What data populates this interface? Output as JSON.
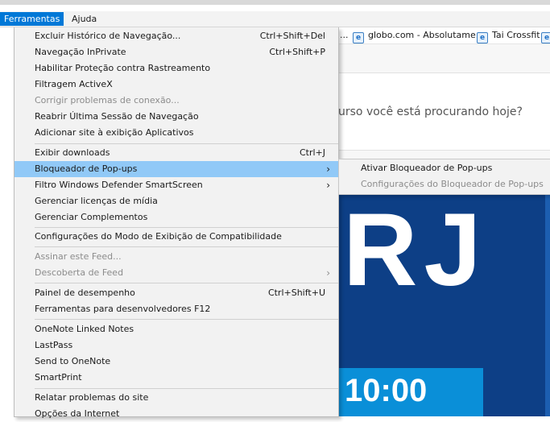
{
  "menubar": {
    "items": [
      {
        "label": "Ferramentas",
        "active": true
      },
      {
        "label": "Ajuda",
        "active": false
      }
    ]
  },
  "favorites": {
    "items": [
      {
        "label": "...",
        "icon": "ie-page-icon"
      },
      {
        "label": "globo.com - Absolutame...",
        "icon": "ie-page-icon"
      },
      {
        "label": "Tai Crossfit",
        "icon": "ie-page-icon"
      }
    ]
  },
  "page": {
    "search_prompt": "urso você está procurando hoje?",
    "banner_text": "RJ",
    "banner_time": "10:00"
  },
  "tools_menu": {
    "items": [
      {
        "label": "Excluir Histórico de Navegação...",
        "shortcut": "Ctrl+Shift+Del"
      },
      {
        "label": "Navegação InPrivate",
        "shortcut": "Ctrl+Shift+P"
      },
      {
        "label": "Habilitar Proteção contra Rastreamento"
      },
      {
        "label": "Filtragem ActiveX"
      },
      {
        "label": "Corrigir problemas de conexão...",
        "disabled": true
      },
      {
        "label": "Reabrir Última Sessão de Navegação"
      },
      {
        "label": "Adicionar site à exibição Aplicativos"
      },
      {
        "label": "Exibir downloads",
        "shortcut": "Ctrl+J"
      },
      {
        "label": "Bloqueador de Pop-ups",
        "submenu": true
      },
      {
        "label": "Filtro Windows Defender SmartScreen",
        "submenu": true
      },
      {
        "label": "Gerenciar licenças de mídia"
      },
      {
        "label": "Gerenciar Complementos"
      },
      {
        "label": "Configurações do Modo de Exibição de Compatibilidade"
      },
      {
        "label": "Assinar este Feed...",
        "disabled": true
      },
      {
        "label": "Descoberta de Feed",
        "disabled": true,
        "submenu": true
      },
      {
        "label": "Painel de desempenho",
        "shortcut": "Ctrl+Shift+U"
      },
      {
        "label": "Ferramentas para desenvolvedores F12"
      },
      {
        "label": "OneNote Linked Notes"
      },
      {
        "label": "LastPass"
      },
      {
        "label": "Send to OneNote"
      },
      {
        "label": "SmartPrint"
      },
      {
        "label": "Relatar problemas do site"
      },
      {
        "label": "Opções da Internet"
      }
    ]
  },
  "popup_submenu": {
    "items": [
      {
        "label": "Ativar Bloqueador de Pop-ups"
      },
      {
        "label": "Configurações do Bloqueador de Pop-ups",
        "disabled": true
      }
    ]
  },
  "colors": {
    "accent": "#0078d7",
    "highlight": "#91c9f7",
    "banner": "#0d3f86"
  }
}
